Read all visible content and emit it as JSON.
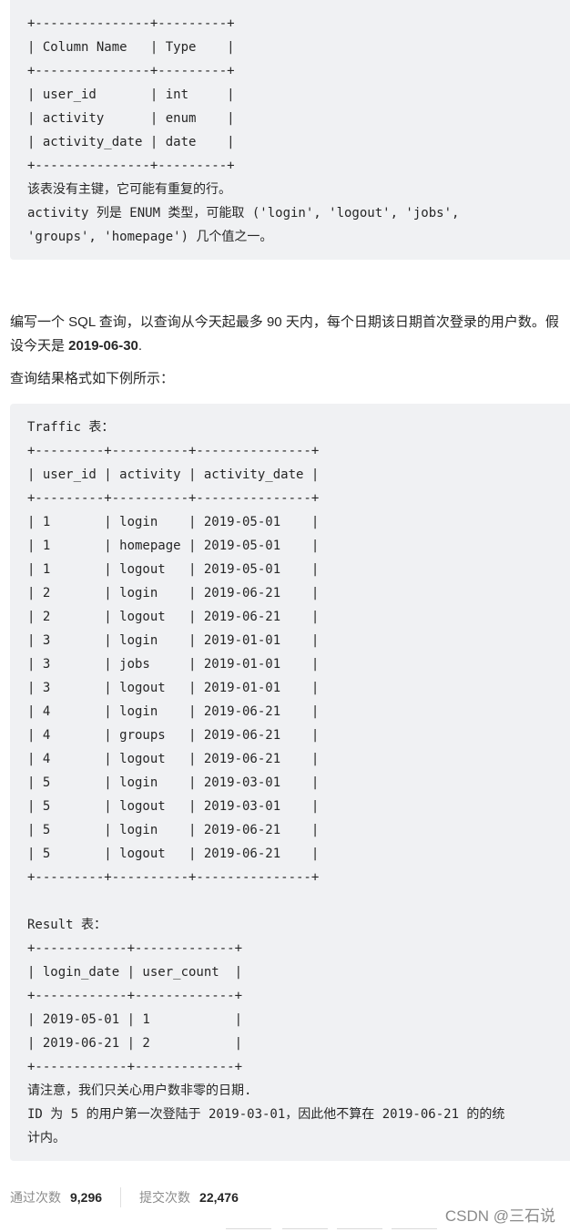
{
  "schema_block": {
    "lines": [
      "+---------------+---------+",
      "| Column Name   | Type    |",
      "+---------------+---------+",
      "| user_id       | int     |",
      "| activity      | enum    |",
      "| activity_date | date    |",
      "+---------------+---------+",
      "该表没有主键，它可能有重复的行。",
      "activity 列是 ENUM 类型，可能取 ('login', 'logout', 'jobs',",
      "'groups', 'homepage') 几个值之一。"
    ]
  },
  "description": {
    "text_before": "编写一个 SQL 查询，以查询从今天起最多 90 天内，每个日期该日期首次登录的用户数。假设今天是 ",
    "today_bold": "2019-06-30",
    "text_after": ".",
    "format_intro": "查询结果格式如下例所示："
  },
  "example_block": {
    "traffic_title": "Traffic 表：",
    "traffic_lines": [
      "+---------+----------+---------------+",
      "| user_id | activity | activity_date |",
      "+---------+----------+---------------+",
      "| 1       | login    | 2019-05-01    |",
      "| 1       | homepage | 2019-05-01    |",
      "| 1       | logout   | 2019-05-01    |",
      "| 2       | login    | 2019-06-21    |",
      "| 2       | logout   | 2019-06-21    |",
      "| 3       | login    | 2019-01-01    |",
      "| 3       | jobs     | 2019-01-01    |",
      "| 3       | logout   | 2019-01-01    |",
      "| 4       | login    | 2019-06-21    |",
      "| 4       | groups   | 2019-06-21    |",
      "| 4       | logout   | 2019-06-21    |",
      "| 5       | login    | 2019-03-01    |",
      "| 5       | logout   | 2019-03-01    |",
      "| 5       | login    | 2019-06-21    |",
      "| 5       | logout   | 2019-06-21    |",
      "+---------+----------+---------------+"
    ],
    "result_title": "Result 表：",
    "result_lines": [
      "+------------+-------------+",
      "| login_date | user_count  |",
      "+------------+-------------+",
      "| 2019-05-01 | 1           |",
      "| 2019-06-21 | 2           |",
      "+------------+-------------+"
    ],
    "notes": [
      "请注意，我们只关心用户数非零的日期.",
      "ID 为 5 的用户第一次登陆于 2019-03-01，因此他不算在 2019-06-21 的的统",
      "计内。"
    ]
  },
  "stats": {
    "accepted_label": "通过次数",
    "accepted_value": "9,296",
    "submissions_label": "提交次数",
    "submissions_value": "22,476"
  },
  "watermark": "CSDN @三石说"
}
